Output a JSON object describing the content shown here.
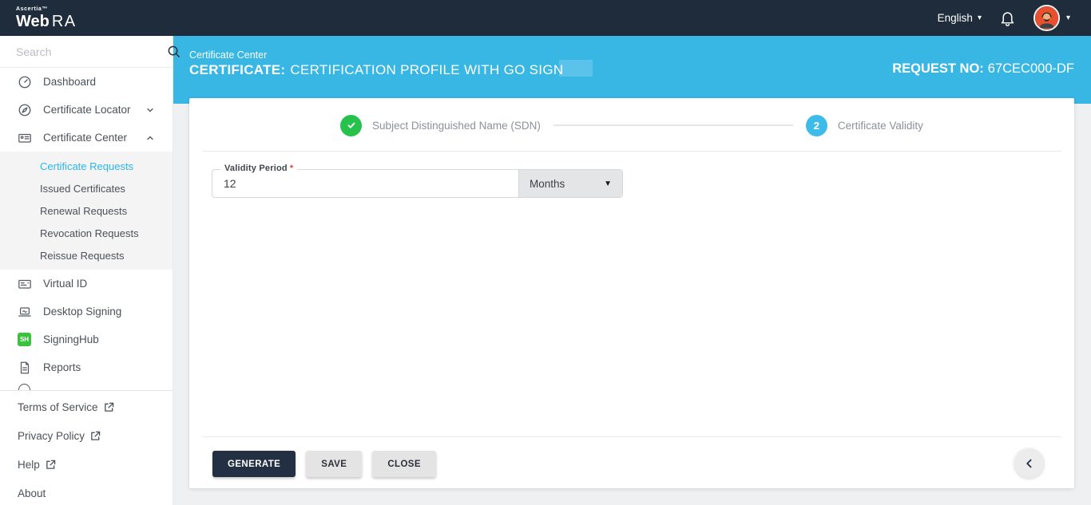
{
  "brand": {
    "company": "Ascertia™",
    "product_web": "Web",
    "product_ra": "RA"
  },
  "topbar": {
    "language": "English"
  },
  "sidebar": {
    "search_placeholder": "Search",
    "items": [
      {
        "label": "Dashboard",
        "icon": "dashboard-gauge-icon"
      },
      {
        "label": "Certificate Locator",
        "icon": "compass-icon"
      },
      {
        "label": "Certificate Center",
        "icon": "id-card-icon"
      },
      {
        "label": "Virtual ID",
        "icon": "virtual-id-card-icon"
      },
      {
        "label": "Desktop Signing",
        "icon": "laptop-signing-icon"
      },
      {
        "label": "SigningHub",
        "icon": "signinghub-badge-icon"
      },
      {
        "label": "Reports",
        "icon": "report-document-icon"
      }
    ],
    "certificate_center_submenu": [
      "Certificate Requests",
      "Issued Certificates",
      "Renewal Requests",
      "Revocation Requests",
      "Reissue Requests"
    ],
    "active_submenu_item": "Certificate Requests",
    "footer_links": [
      "Terms of Service",
      "Privacy Policy",
      "Help",
      "About"
    ]
  },
  "header": {
    "breadcrumb": "Certificate Center",
    "title_label": "CERTIFICATE:",
    "title_value": "CERTIFICATION PROFILE WITH GO SIGN",
    "request_label": "REQUEST NO:",
    "request_value": "67CEC000-DF"
  },
  "stepper": {
    "step1_label": "Subject Distinguished Name (SDN)",
    "step1_state": "complete",
    "step2_number": "2",
    "step2_label": "Certificate Validity",
    "step2_state": "active"
  },
  "form": {
    "validity_label": "Validity Period",
    "required_marker": "*",
    "validity_value": "12",
    "unit_value": "Months"
  },
  "actions": {
    "generate": "GENERATE",
    "save": "SAVE",
    "close": "CLOSE"
  },
  "icons": {
    "caret_down": "▾",
    "dropdown_caret": "▼",
    "signinghub_badge": "SH",
    "search": "magnifier",
    "bell": "notification-bell",
    "back": "chevron-left",
    "external_link": "box-arrow-up-right",
    "step_done": "checkmark"
  },
  "colors": {
    "navbar_navy": "#1e2c3c",
    "accent_cyan": "#38b6e4",
    "active_link_cyan": "#29b6f0",
    "step_complete_green": "#27c24c",
    "step_active_blue": "#3dbce9",
    "primary_button_navy": "#233044",
    "required_red": "#e0403a",
    "signinghub_green": "#3cc13c",
    "avatar_red": "#e8502e"
  }
}
